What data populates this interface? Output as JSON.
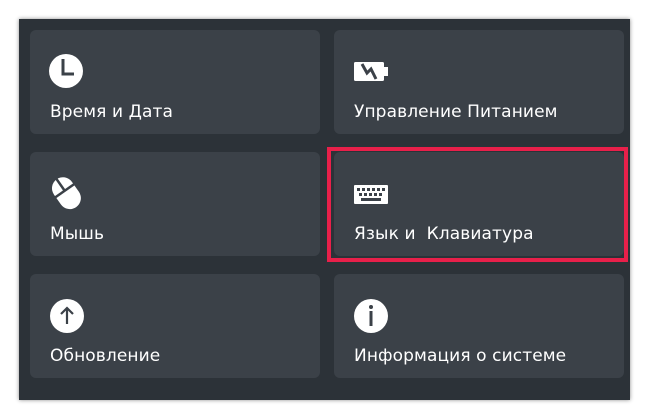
{
  "tiles": [
    {
      "label": "Время и Дата",
      "icon": "clock-icon"
    },
    {
      "label": "Управление Питанием",
      "icon": "battery-charging-icon"
    },
    {
      "label": "Мышь",
      "icon": "mouse-icon"
    },
    {
      "label": "Язык и  Клавиатура",
      "icon": "keyboard-icon"
    },
    {
      "label": "Обновление",
      "icon": "update-arrow-icon"
    },
    {
      "label": "Информация о системе",
      "icon": "info-icon"
    }
  ],
  "colors": {
    "panel_bg": "#2c3238",
    "tile_bg": "#3b4148",
    "text": "#ffffff",
    "highlight": "#e8204a"
  }
}
